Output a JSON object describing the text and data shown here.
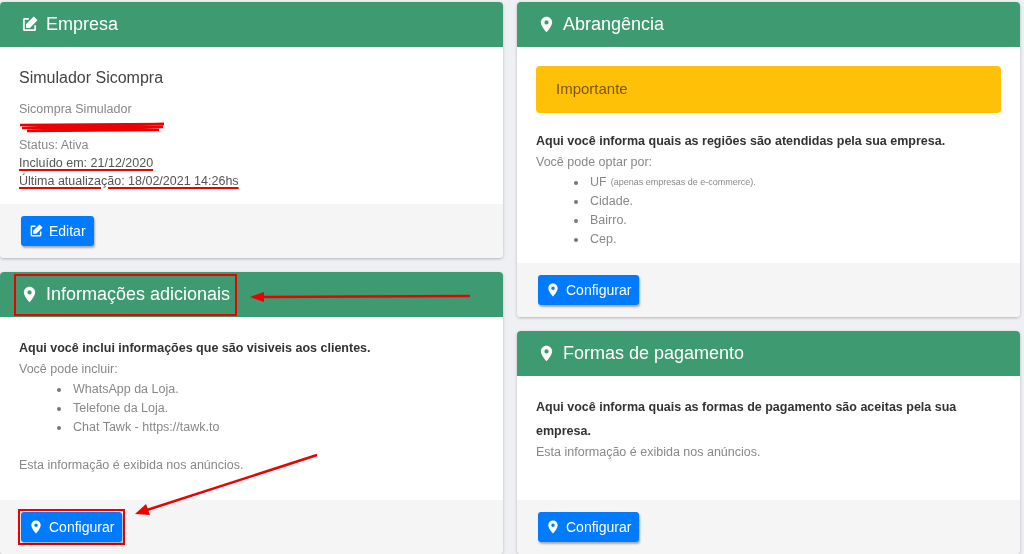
{
  "columns": [
    [
      {
        "title": "Empresa",
        "kind": "editable",
        "highlighted": false,
        "body": [
          {
            "kind": "heading",
            "text": "Simulador Sicompra"
          },
          {
            "kind": "muted",
            "text": "Sicompra Simulador"
          },
          {
            "kind": "redacted"
          },
          {
            "kind": "muted",
            "text": "Status: Ativa"
          },
          {
            "kind": "struck",
            "text": "Incluído em: 21/12/2020"
          },
          {
            "kind": "struck",
            "text": "Última atualização: 18/02/2021 14:26hs"
          }
        ],
        "button": {
          "label": "Editar",
          "highlighted": false
        }
      },
      {
        "title": "Informações adicionais",
        "kind": "configurable",
        "highlighted": true,
        "body": [
          {
            "kind": "lead",
            "text": "Aqui você inclui informações que são visiveis aos clientes."
          },
          {
            "kind": "muted",
            "text": "Você pode incluir:"
          },
          {
            "kind": "list",
            "items": [
              {
                "label": "WhatsApp da Loja."
              },
              {
                "label": "Telefone da Loja."
              },
              {
                "label": "Chat Tawk - https://tawk.to"
              }
            ]
          },
          {
            "kind": "note",
            "text": "Esta informação é exibida nos anúncios."
          }
        ],
        "button": {
          "label": "Configurar",
          "highlighted": true
        }
      }
    ],
    [
      {
        "title": "Abrangência",
        "kind": "configurable",
        "highlighted": false,
        "body": [
          {
            "kind": "alert",
            "text": "Importante"
          },
          {
            "kind": "lead",
            "text": "Aqui você informa quais as regiões são atendidas pela sua empresa."
          },
          {
            "kind": "muted",
            "text": "Você pode optar por:"
          },
          {
            "kind": "list",
            "items": [
              {
                "label": "UF",
                "note": "(apenas empresas de e-commerce)."
              },
              {
                "label": "Cidade."
              },
              {
                "label": "Bairro."
              },
              {
                "label": "Cep."
              }
            ]
          }
        ],
        "button": {
          "label": "Configurar",
          "highlighted": false
        }
      },
      {
        "title": "Formas de pagamento",
        "kind": "configurable",
        "highlighted": false,
        "body": [
          {
            "kind": "lead",
            "text": "Aqui você informa quais as formas de pagamento são aceitas pela sua empresa."
          },
          {
            "kind": "muted",
            "text": "Esta informação é exibida nos anúncios."
          }
        ],
        "button": {
          "label": "Configurar",
          "highlighted": false
        }
      }
    ]
  ]
}
